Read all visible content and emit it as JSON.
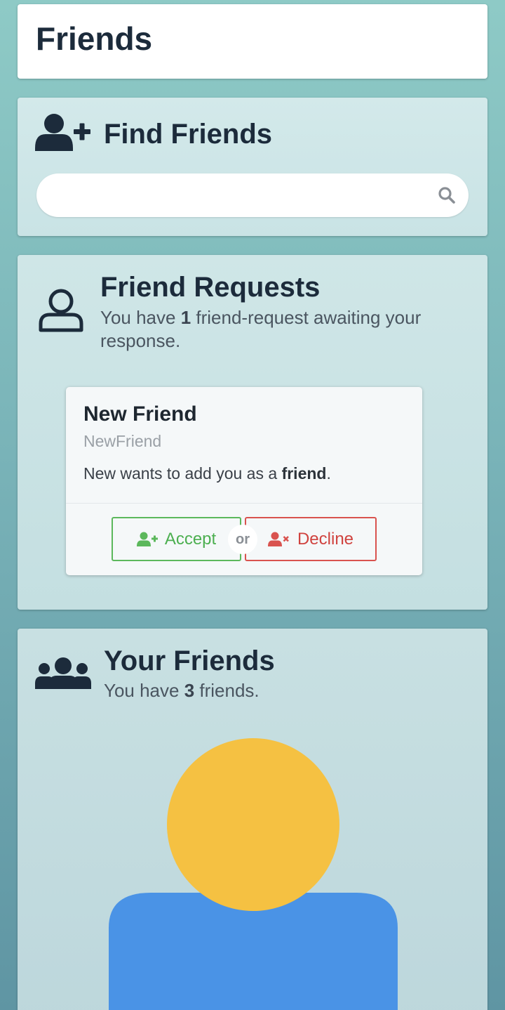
{
  "page": {
    "title": "Friends"
  },
  "find_friends": {
    "heading": "Find Friends",
    "icon": "user-plus-icon",
    "search": {
      "value": "",
      "placeholder": "",
      "icon": "search-icon"
    }
  },
  "friend_requests": {
    "heading": "Friend Requests",
    "icon": "user-outline-icon",
    "summary_prefix": "You have ",
    "count": "1",
    "summary_suffix": " friend-request awaiting your response.",
    "items": [
      {
        "display_name": "New Friend",
        "username": "NewFriend",
        "message_prefix": "New wants to add you as a ",
        "message_bold": "friend",
        "message_suffix": ".",
        "accept_label": "Accept",
        "or_label": "or",
        "decline_label": "Decline"
      }
    ]
  },
  "your_friends": {
    "heading": "Your Friends",
    "icon": "users-group-icon",
    "summary_prefix": "You have ",
    "count": "3",
    "summary_suffix": " friends.",
    "avatar_colors": {
      "head": "#f5c142",
      "body": "#4a93e6"
    }
  },
  "colors": {
    "accept": "#5cb85c",
    "decline": "#d9534f",
    "heading": "#1c2b3b"
  }
}
